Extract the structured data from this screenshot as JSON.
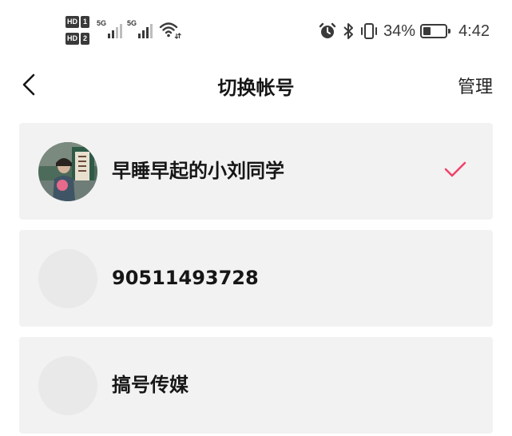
{
  "status_bar": {
    "sim1": {
      "hd": "HD",
      "slot": "1",
      "network": "5G"
    },
    "sim2": {
      "hd": "HD",
      "slot": "2",
      "network": "5G"
    },
    "icons": [
      "alarm-icon",
      "bluetooth-icon",
      "vibrate-icon"
    ],
    "battery_percent_label": "34%",
    "battery_level": 0.34,
    "time": "4:42"
  },
  "header": {
    "title": "切换帐号",
    "manage_label": "管理"
  },
  "accounts": [
    {
      "name": "早睡早起的小刘同学",
      "selected": true,
      "has_photo": true
    },
    {
      "name": "90511493728",
      "selected": false,
      "has_photo": false
    },
    {
      "name": "搞号传媒",
      "selected": false,
      "has_photo": false
    }
  ],
  "colors": {
    "accent_check": "#f0436a",
    "card_bg": "#f2f2f2",
    "text_primary": "#161616"
  }
}
